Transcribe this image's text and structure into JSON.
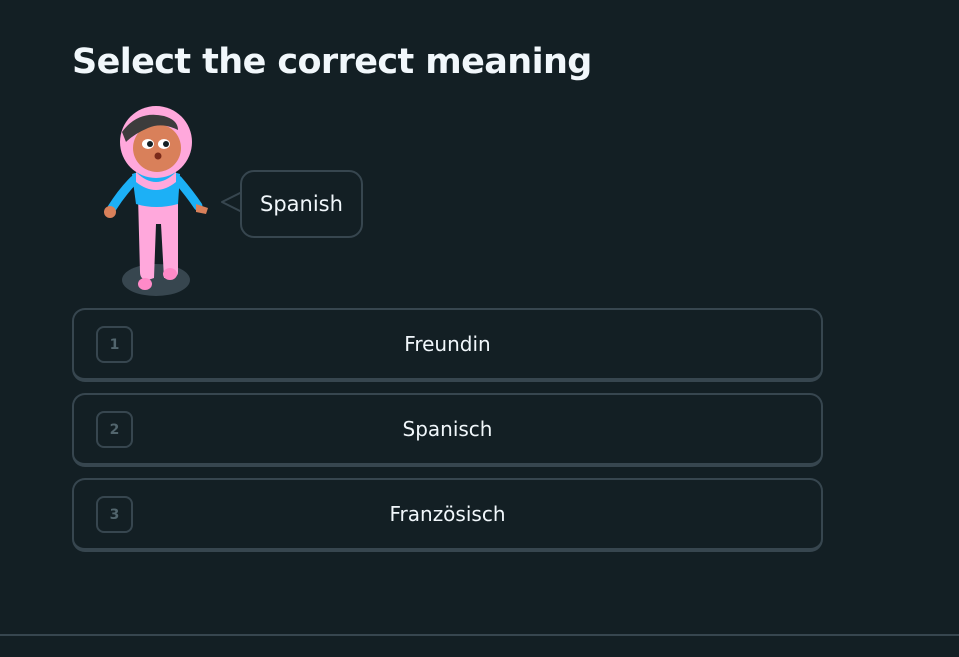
{
  "challenge": {
    "heading": "Select the correct meaning",
    "prompt_word": "Spanish"
  },
  "options": [
    {
      "key": "1",
      "label": "Freundin"
    },
    {
      "key": "2",
      "label": "Spanisch"
    },
    {
      "key": "3",
      "label": "Französisch"
    }
  ],
  "colors": {
    "background": "#131f24",
    "border": "#37464f",
    "text": "#f1f7fb",
    "key_text": "#52656d",
    "character_hijab": "#ffa8dc",
    "character_shirt": "#1cb0f6"
  },
  "icons": {
    "character": "character-illustration"
  }
}
